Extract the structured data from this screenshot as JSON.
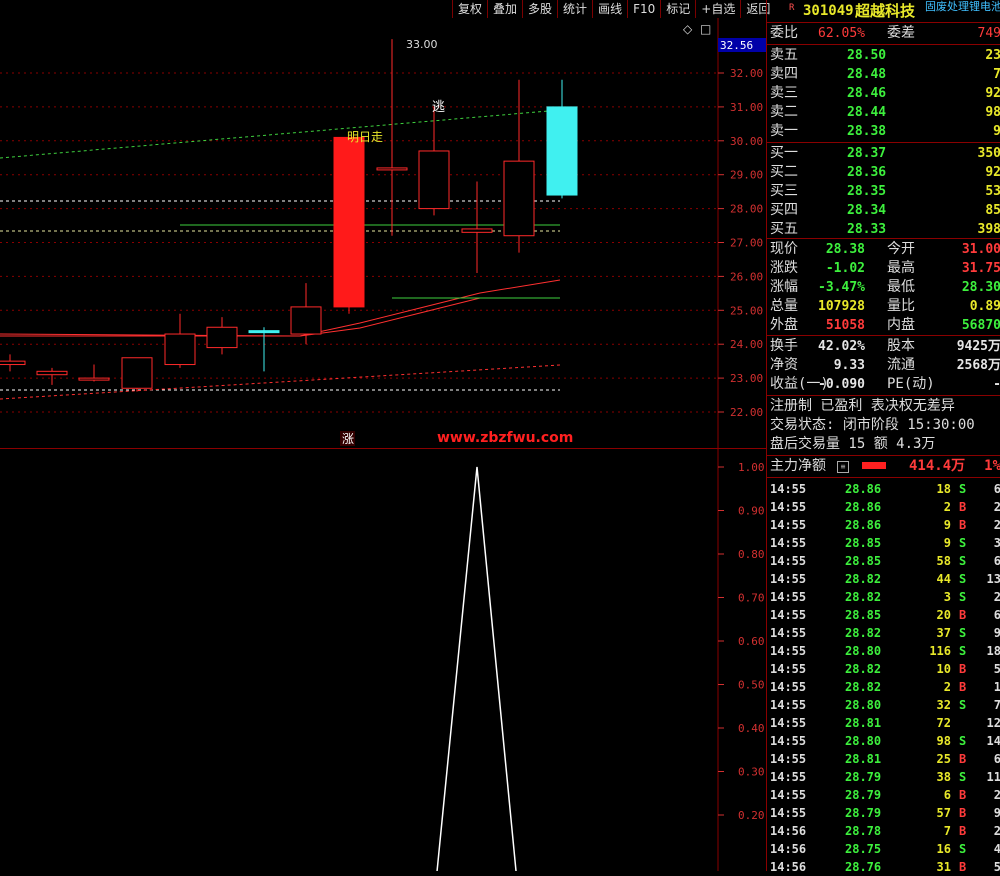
{
  "toolbar": [
    "复权",
    "叠加",
    "多股",
    "统计",
    "画线",
    "F10",
    "标记",
    "+自选",
    "返回"
  ],
  "kchart": {
    "yticks": [
      "32.00",
      "31.00",
      "30.00",
      "29.00",
      "28.00",
      "27.00",
      "26.00",
      "25.00",
      "24.00",
      "23.00",
      "22.00"
    ],
    "current_price_tag": "32.56",
    "high_label": "33.00",
    "annotation_escape": "逃",
    "annotation_tomorrow": "明日走",
    "limit_up_label": "涨",
    "watermark": "www.zbzfwu.com",
    "candles": [
      {
        "o": 23.4,
        "c": 23.5,
        "h": 23.7,
        "l": 23.2
      },
      {
        "o": 23.2,
        "c": 23.1,
        "h": 23.3,
        "l": 22.8
      },
      {
        "o": 23.0,
        "c": 23.0,
        "h": 23.4,
        "l": 22.9
      },
      {
        "o": 22.7,
        "c": 23.6,
        "h": 23.6,
        "l": 22.6
      },
      {
        "o": 23.4,
        "c": 24.3,
        "h": 24.9,
        "l": 23.3
      },
      {
        "o": 23.9,
        "c": 24.5,
        "h": 24.8,
        "l": 23.7
      },
      {
        "o": 24.4,
        "c": 24.4,
        "h": 24.5,
        "l": 23.2,
        "cyan": true
      },
      {
        "o": 24.3,
        "c": 25.1,
        "h": 25.8,
        "l": 24.0
      },
      {
        "o": 25.1,
        "c": 30.1,
        "h": 30.1,
        "l": 24.9,
        "solid": true
      },
      {
        "o": 29.2,
        "c": 29.2,
        "h": 33.0,
        "l": 27.2
      },
      {
        "o": 28.0,
        "c": 29.7,
        "h": 31.0,
        "l": 27.8
      },
      {
        "o": 27.3,
        "c": 27.4,
        "h": 28.8,
        "l": 26.1
      },
      {
        "o": 27.2,
        "c": 29.4,
        "h": 31.8,
        "l": 26.7
      },
      {
        "o": 28.4,
        "c": 31.0,
        "h": 31.8,
        "l": 28.3,
        "cyan": true
      }
    ]
  },
  "indicator": {
    "yticks": [
      "1.00",
      "0.90",
      "0.80",
      "0.70",
      "0.60",
      "0.50",
      "0.40",
      "0.30",
      "0.20"
    ],
    "values": [
      0,
      0,
      0,
      0,
      0,
      0,
      0,
      0,
      0,
      0,
      0,
      1,
      0,
      0
    ]
  },
  "quote": {
    "badge": "R",
    "code": "301049",
    "name": "超越科技",
    "concept": "固废处理锂电池",
    "weibi_label": "委比",
    "weibi": "62.05%",
    "weicha_label": "委差",
    "weicha": "749",
    "asks": [
      {
        "label": "卖五",
        "price": "28.50",
        "vol": "23"
      },
      {
        "label": "卖四",
        "price": "28.48",
        "vol": "7"
      },
      {
        "label": "卖三",
        "price": "28.46",
        "vol": "92"
      },
      {
        "label": "卖二",
        "price": "28.44",
        "vol": "98"
      },
      {
        "label": "卖一",
        "price": "28.38",
        "vol": "9"
      }
    ],
    "bids": [
      {
        "label": "买一",
        "price": "28.37",
        "vol": "350"
      },
      {
        "label": "买二",
        "price": "28.36",
        "vol": "92"
      },
      {
        "label": "买三",
        "price": "28.35",
        "vol": "53"
      },
      {
        "label": "买四",
        "price": "28.34",
        "vol": "85"
      },
      {
        "label": "买五",
        "price": "28.33",
        "vol": "398"
      }
    ],
    "stats": [
      {
        "l1": "现价",
        "v1": "28.38",
        "cls1": "green",
        "l2": "今开",
        "v2": "31.00",
        "cls2": "red"
      },
      {
        "l1": "涨跌",
        "v1": "-1.02",
        "cls1": "green",
        "l2": "最高",
        "v2": "31.75",
        "cls2": "red"
      },
      {
        "l1": "涨幅",
        "v1": "-3.47%",
        "cls1": "green",
        "l2": "最低",
        "v2": "28.30",
        "cls2": "green"
      },
      {
        "l1": "总量",
        "v1": "107928",
        "cls1": "yellow",
        "l2": "量比",
        "v2": "0.89",
        "cls2": "yellow"
      },
      {
        "l1": "外盘",
        "v1": "51058",
        "cls1": "red",
        "l2": "内盘",
        "v2": "56870",
        "cls2": "green"
      }
    ],
    "stats2": [
      {
        "l1": "换手",
        "v1": "42.02%",
        "l2": "股本",
        "v2": "9425万"
      },
      {
        "l1": "净资",
        "v1": "9.33",
        "l2": "流通",
        "v2": "2568万"
      },
      {
        "l1": "收益(一)",
        "v1": "-0.090",
        "l2": "PE(动)",
        "v2": "-"
      }
    ],
    "info1": "注册制 已盈利 表决权无差异",
    "info2": "交易状态: 闭市阶段 15:30:00",
    "info3": "盘后交易量 15 额 4.3万",
    "netflow_label": "主力净额",
    "netflow_value": "414.4万",
    "netflow_pct": "1%"
  },
  "trades": [
    {
      "t": "14:55",
      "p": "28.86",
      "v": "18",
      "bs": "S",
      "n": "6"
    },
    {
      "t": "14:55",
      "p": "28.86",
      "v": "2",
      "bs": "B",
      "n": "2"
    },
    {
      "t": "14:55",
      "p": "28.86",
      "v": "9",
      "bs": "B",
      "n": "2"
    },
    {
      "t": "14:55",
      "p": "28.85",
      "v": "9",
      "bs": "S",
      "n": "3"
    },
    {
      "t": "14:55",
      "p": "28.85",
      "v": "58",
      "bs": "S",
      "n": "6"
    },
    {
      "t": "14:55",
      "p": "28.82",
      "v": "44",
      "bs": "S",
      "n": "13"
    },
    {
      "t": "14:55",
      "p": "28.82",
      "v": "3",
      "bs": "S",
      "n": "2"
    },
    {
      "t": "14:55",
      "p": "28.85",
      "v": "20",
      "bs": "B",
      "n": "6"
    },
    {
      "t": "14:55",
      "p": "28.82",
      "v": "37",
      "bs": "S",
      "n": "9"
    },
    {
      "t": "14:55",
      "p": "28.80",
      "v": "116",
      "bs": "S",
      "n": "18"
    },
    {
      "t": "14:55",
      "p": "28.82",
      "v": "10",
      "bs": "B",
      "n": "5"
    },
    {
      "t": "14:55",
      "p": "28.82",
      "v": "2",
      "bs": "B",
      "n": "1"
    },
    {
      "t": "14:55",
      "p": "28.80",
      "v": "32",
      "bs": "S",
      "n": "7"
    },
    {
      "t": "14:55",
      "p": "28.81",
      "v": "72",
      "bs": "",
      "n": "12"
    },
    {
      "t": "14:55",
      "p": "28.80",
      "v": "98",
      "bs": "S",
      "n": "14"
    },
    {
      "t": "14:55",
      "p": "28.81",
      "v": "25",
      "bs": "B",
      "n": "6"
    },
    {
      "t": "14:55",
      "p": "28.79",
      "v": "38",
      "bs": "S",
      "n": "11"
    },
    {
      "t": "14:55",
      "p": "28.79",
      "v": "6",
      "bs": "B",
      "n": "2"
    },
    {
      "t": "14:55",
      "p": "28.79",
      "v": "57",
      "bs": "B",
      "n": "9"
    },
    {
      "t": "14:56",
      "p": "28.78",
      "v": "7",
      "bs": "B",
      "n": "2"
    },
    {
      "t": "14:56",
      "p": "28.75",
      "v": "16",
      "bs": "S",
      "n": "4"
    },
    {
      "t": "14:56",
      "p": "28.76",
      "v": "31",
      "bs": "B",
      "n": "5"
    }
  ],
  "colors": {
    "up": "#ff2a2a",
    "down": "#40f0f0",
    "grid": "#8a0000",
    "axis": "#d23030"
  }
}
